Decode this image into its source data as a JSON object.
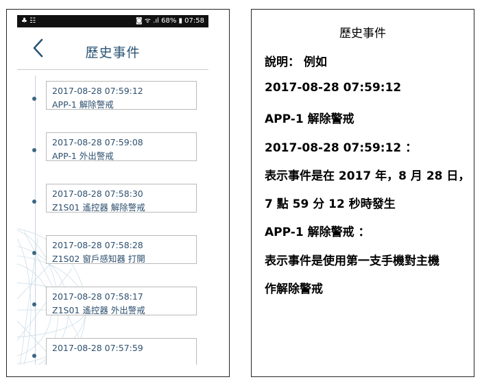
{
  "phone": {
    "statusbar": {
      "left_icons": "♣ ☷",
      "right_text": "◙ ᯤ .ıl 68% ▮ 07:58",
      "battery": "68%",
      "time": "07:58"
    },
    "title": "歷史事件",
    "events": [
      {
        "time": "2017-08-28 07:59:12",
        "desc": "APP-1 解除警戒"
      },
      {
        "time": "2017-08-28 07:59:08",
        "desc": "APP-1 外出警戒"
      },
      {
        "time": "2017-08-28 07:58:30",
        "desc": "Z1S01 遙控器 解除警戒"
      },
      {
        "time": "2017-08-28 07:58:28",
        "desc": "Z1S02 窗戶感知器 打開"
      },
      {
        "time": "2017-08-28 07:58:17",
        "desc": "Z1S01 遙控器 外出警戒"
      },
      {
        "time": "2017-08-28 07:57:59",
        "desc": ""
      }
    ]
  },
  "explanation": {
    "title": "歷史事件",
    "lines": [
      "說明： 例如",
      "2017-08-28 07:59:12",
      "APP-1 解除警戒",
      "2017-08-28 07:59:12 ：",
      "表示事件是在 2017 年，8 月 28 日，",
      "7 點 59 分 12 秒時發生",
      "APP-1 解除警戒 ：",
      "表示事件是使用第一支手機對主機",
      "作解除警戒"
    ]
  },
  "colors": {
    "title_blue": "#2a5575",
    "event_text": "#2d4f6f",
    "timeline_dot": "#3d6684"
  }
}
